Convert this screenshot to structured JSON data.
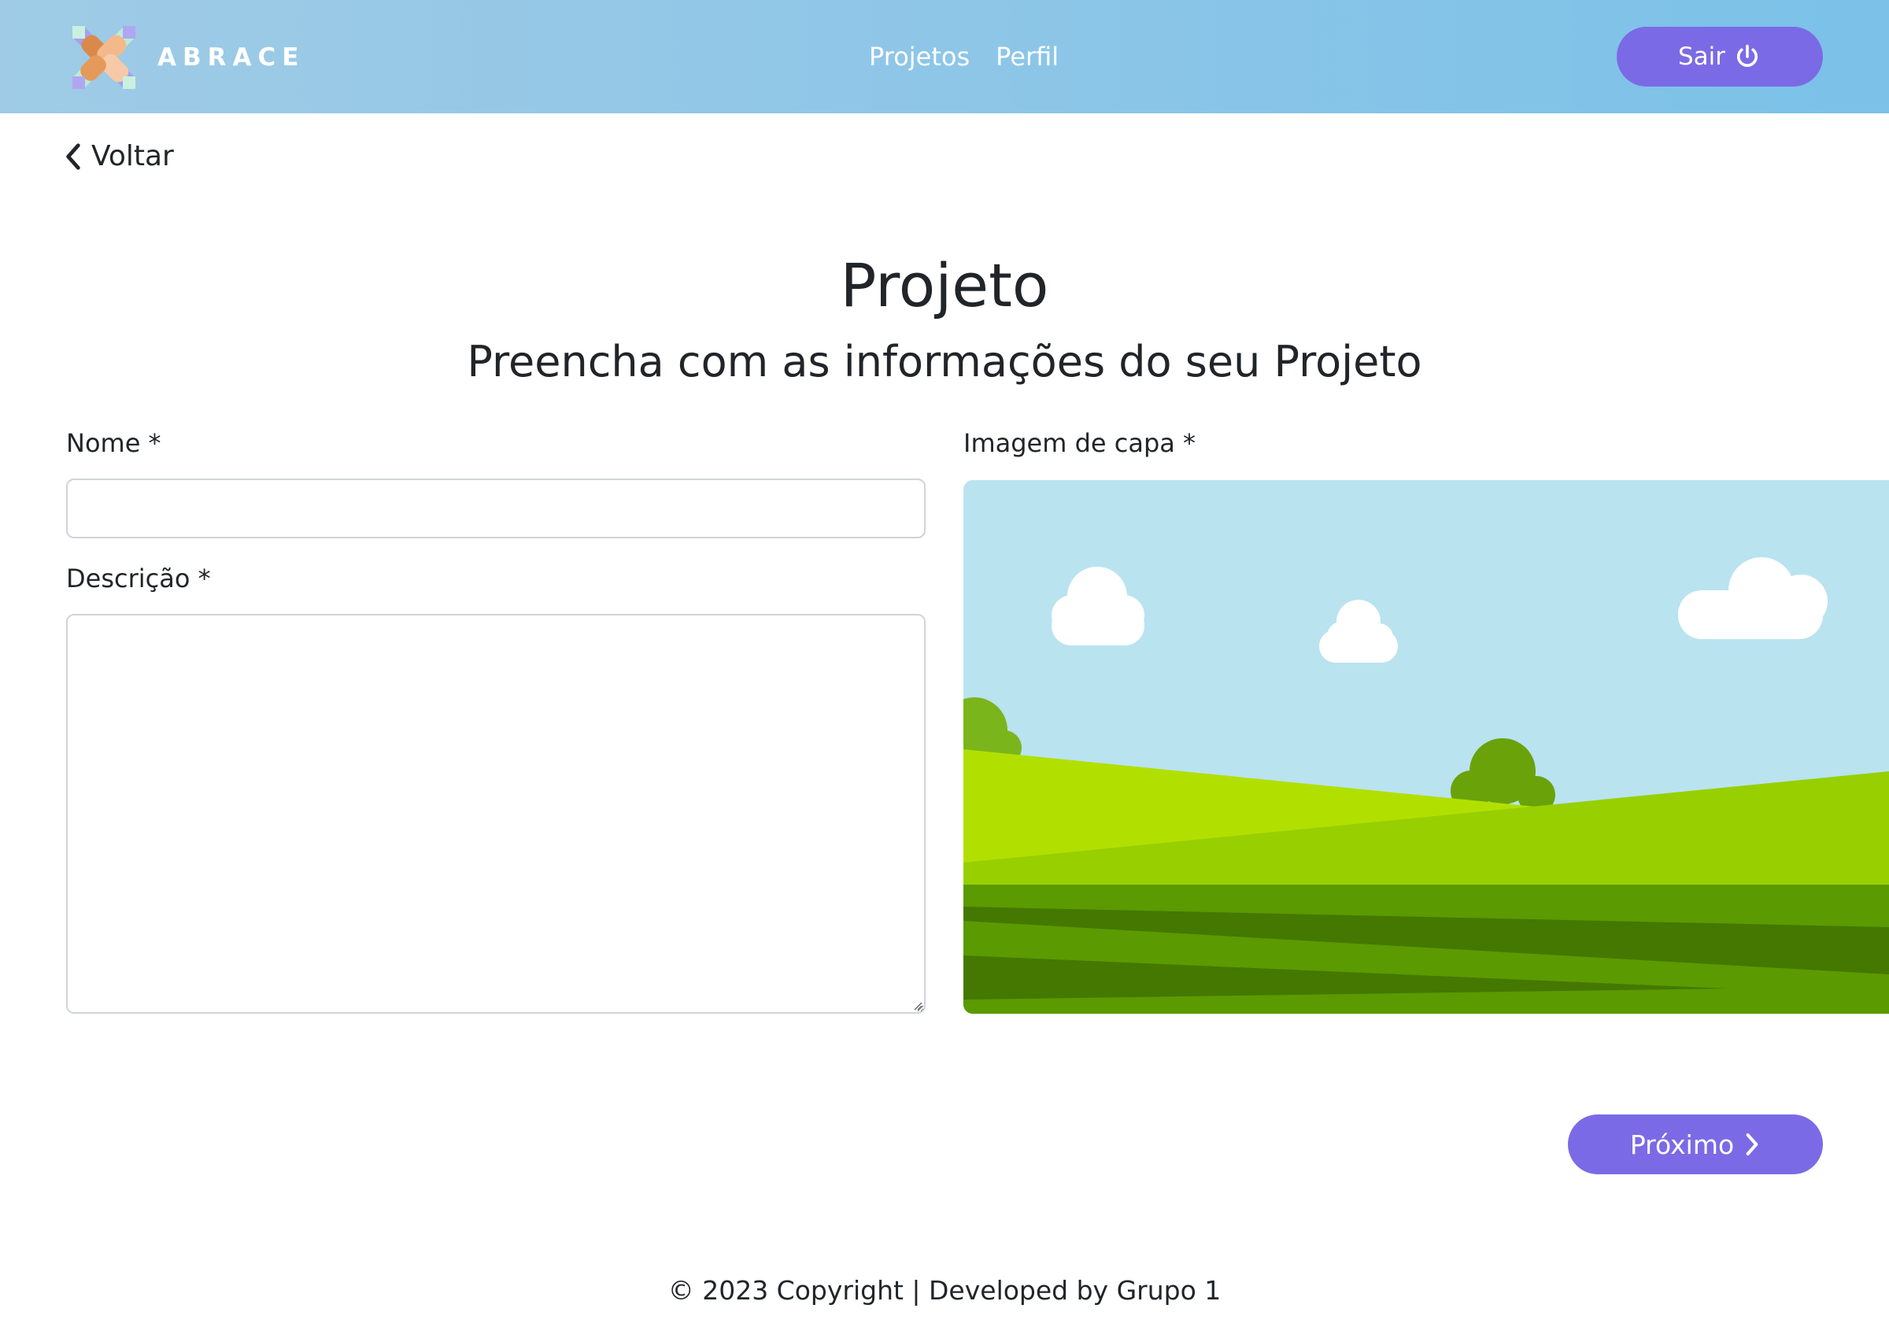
{
  "header": {
    "brand_name": "ABRACE",
    "logo_icon": "hands-together-logo-icon",
    "nav": [
      {
        "label": "Projetos"
      },
      {
        "label": "Perfil"
      }
    ],
    "logout_label": "Sair",
    "logout_icon": "power-icon"
  },
  "back": {
    "label": "Voltar",
    "icon": "chevron-left-icon"
  },
  "page": {
    "title": "Projeto",
    "subtitle": "Preencha com as informações do seu Projeto"
  },
  "form": {
    "name_label": "Nome *",
    "name_value": "",
    "description_label": "Descrição *",
    "description_value": "",
    "cover_label": "Imagem de capa *",
    "cover_placeholder_icon": "landscape-image-placeholder"
  },
  "actions": {
    "next_label": "Próximo",
    "next_icon": "chevron-right-icon"
  },
  "footer": {
    "text": "© 2023 Copyright | Developed by Grupo 1"
  },
  "colors": {
    "header_gradient_start": "#9fcbe6",
    "header_gradient_end": "#7bc1e8",
    "primary_button": "#7b6ae6",
    "text": "#212529",
    "input_border": "#d0d4da"
  }
}
